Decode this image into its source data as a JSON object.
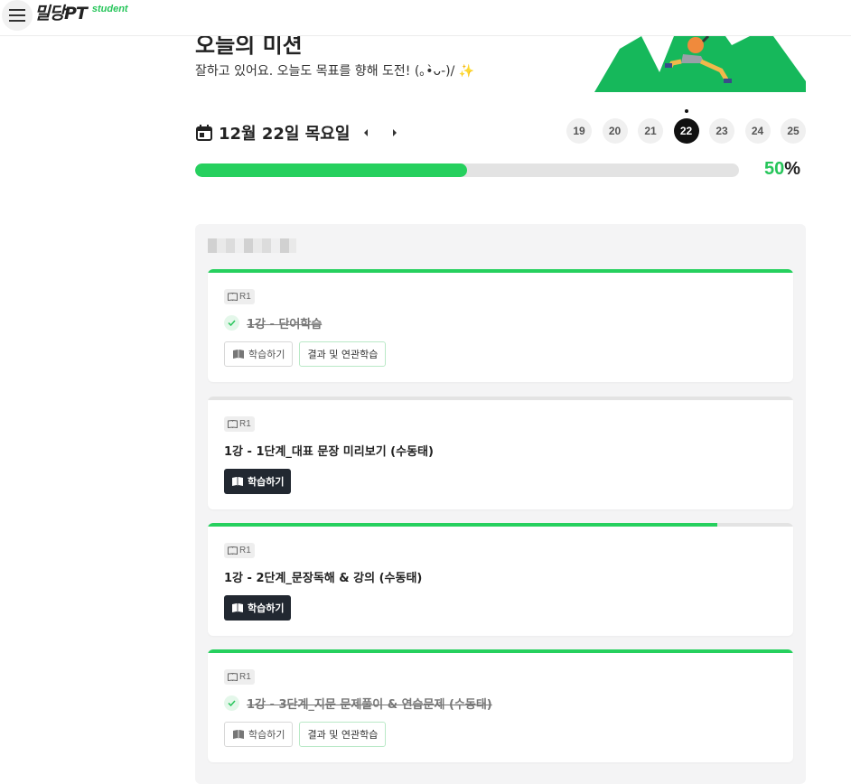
{
  "header": {
    "logo_main": "밀당PT",
    "logo_sub": "student"
  },
  "hero": {
    "title": "오늘의 미션",
    "subtitle": "잘하고 있어요. 오늘도 목표를 향해 도전! (｡•̀ᴗ-)/ ✨"
  },
  "date_nav": {
    "date": "12월 22일 목요일",
    "days": [
      "19",
      "20",
      "21",
      "22",
      "23",
      "24",
      "25"
    ],
    "active_day": "22"
  },
  "progress": {
    "percent": 50,
    "value": "50",
    "unit": "%"
  },
  "colors": {
    "accent": "#26d05e",
    "dark_button": "#222831",
    "panel_bg": "#f4f4f5"
  },
  "tasks": [
    {
      "tag": "R1",
      "title": "1강 - 단어학습",
      "done": true,
      "progress": 1.0,
      "study_label": "학습하기",
      "result_label": "결과 및 연관학습"
    },
    {
      "tag": "R1",
      "title": "1강 - 1단계_대표 문장 미리보기 (수동태)",
      "done": false,
      "progress": 0.0,
      "study_label": "학습하기"
    },
    {
      "tag": "R1",
      "title": "1강 - 2단계_문장독해 & 강의 (수동태)",
      "done": false,
      "progress": 0.87,
      "study_label": "학습하기"
    },
    {
      "tag": "R1",
      "title": "1강 - 3단계_지문 문제풀이 & 연습문제 (수동태)",
      "done": true,
      "progress": 1.0,
      "study_label": "학습하기",
      "result_label": "결과 및 연관학습"
    }
  ]
}
